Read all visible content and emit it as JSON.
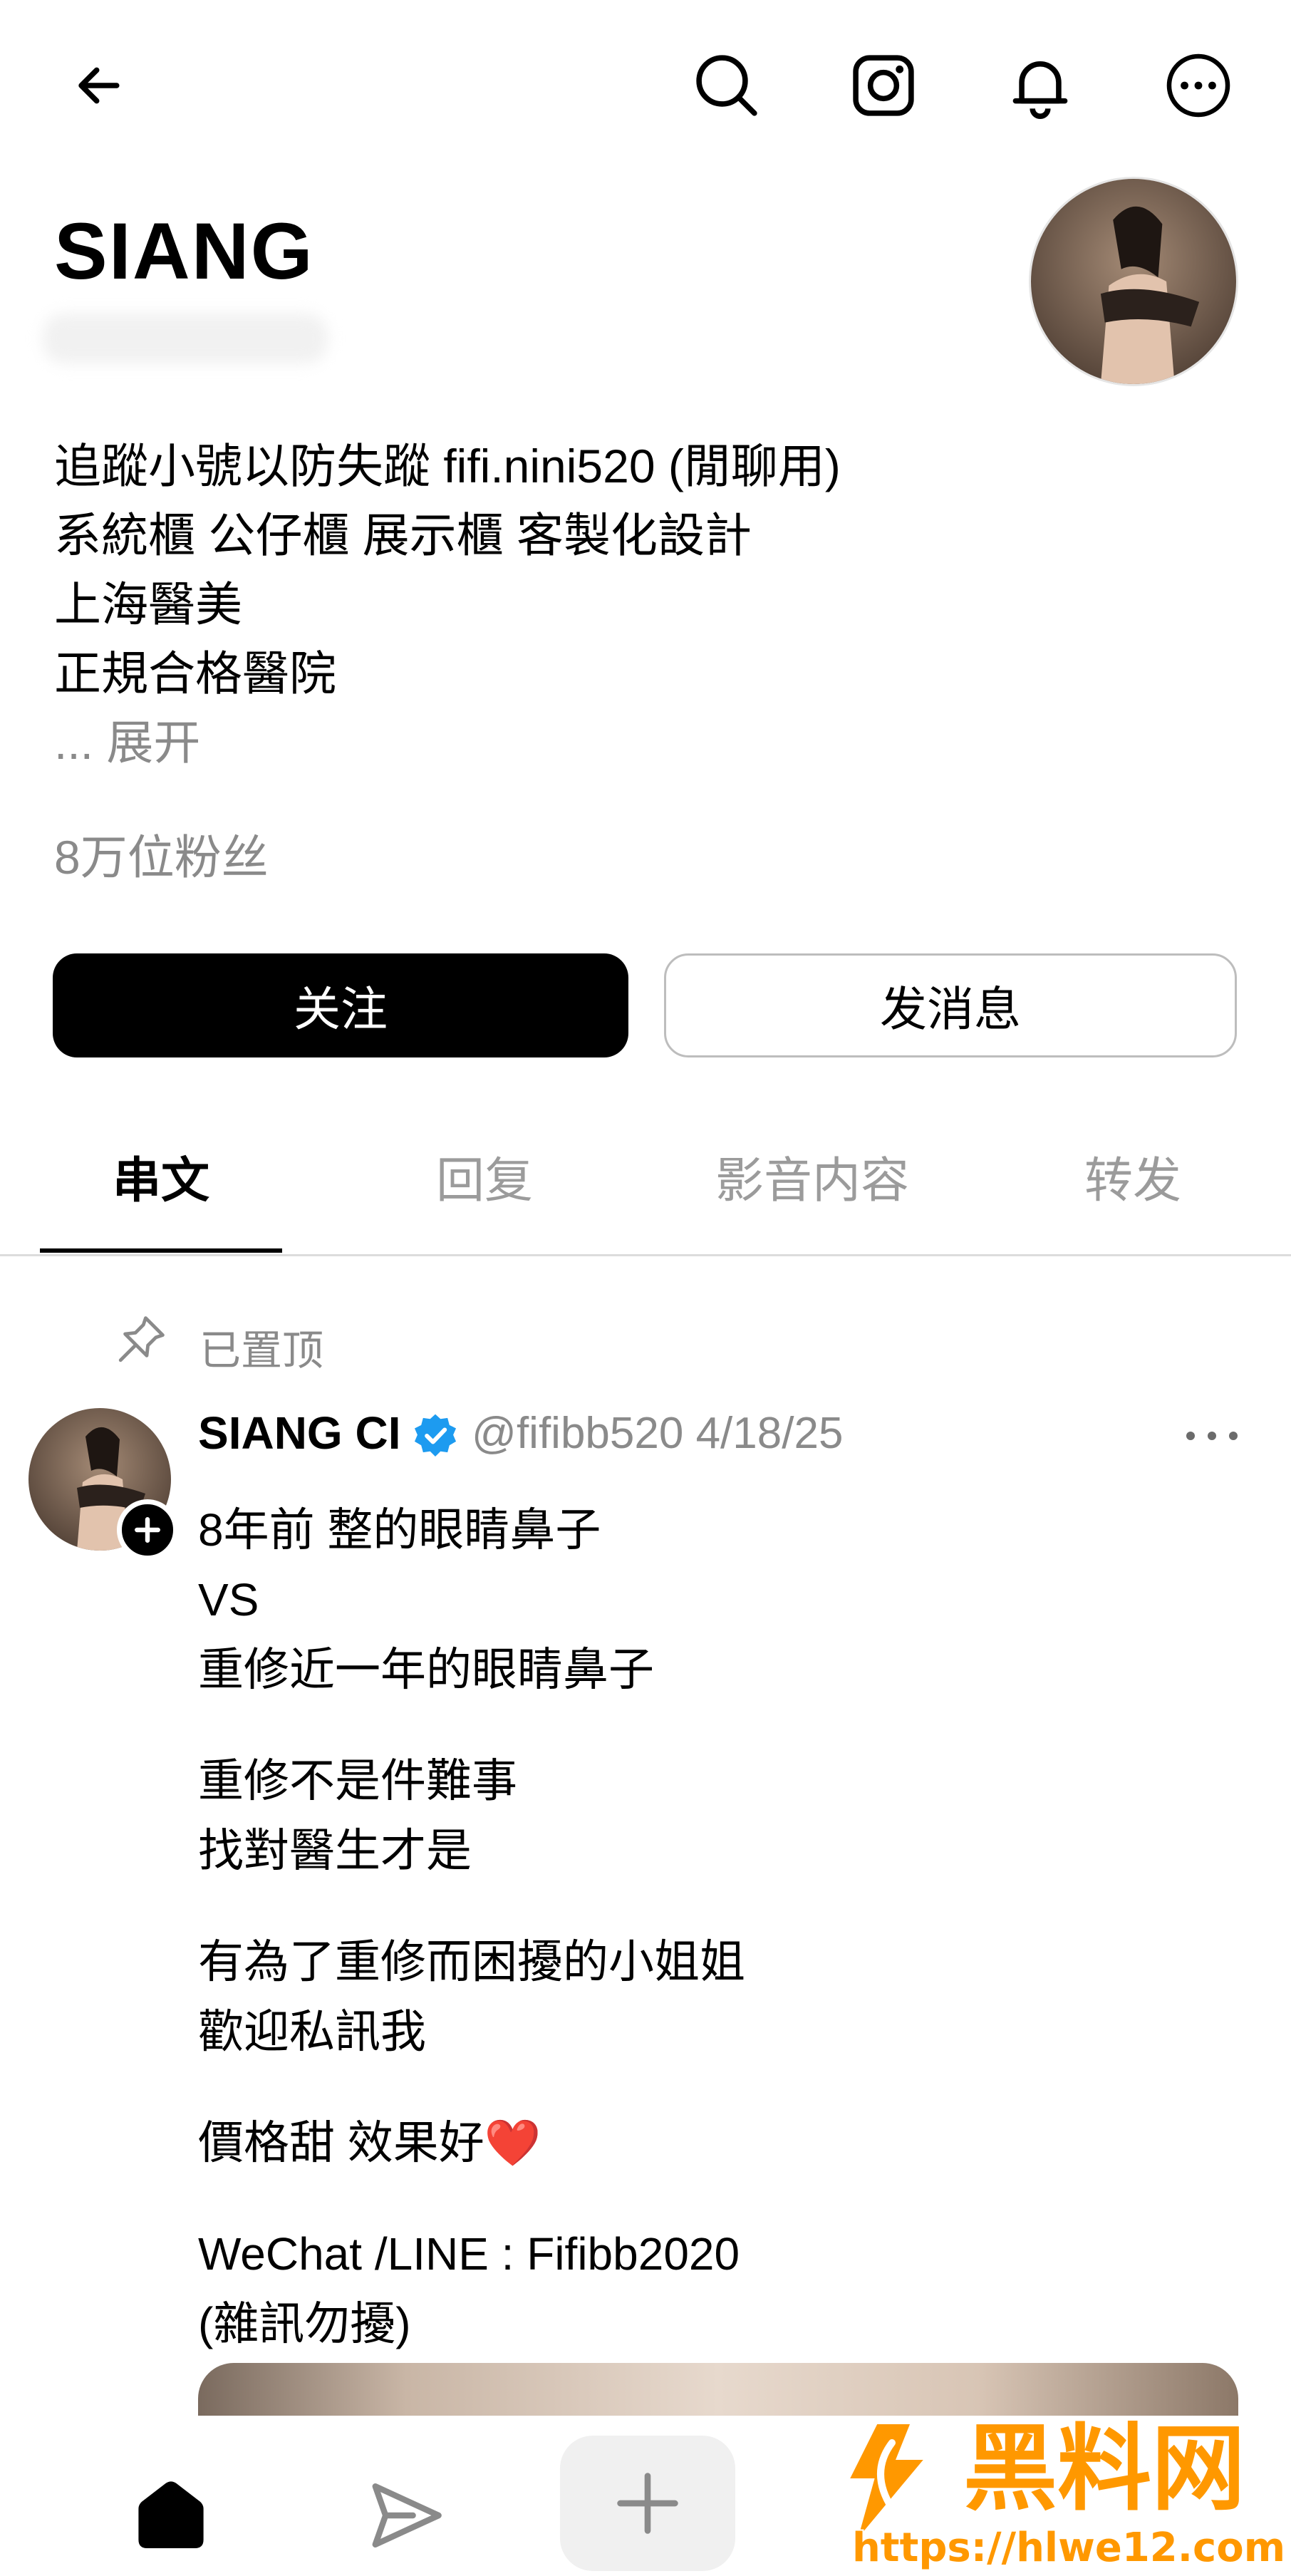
{
  "topbar": {
    "icons": [
      "back-arrow-icon",
      "search-icon",
      "instagram-icon",
      "bell-icon",
      "more-horizontal-icon"
    ]
  },
  "profile": {
    "name": "SIANG",
    "bio_lines": [
      "追蹤小號以防失蹤 fifi.nini520 (閒聊用)",
      "系統櫃 公仔櫃 展示櫃 客製化設計",
      "上海醫美",
      "正規合格醫院"
    ],
    "expand_label": "... 展开",
    "followers": "8万位粉丝"
  },
  "actions": {
    "follow_label": "关注",
    "message_label": "发消息"
  },
  "tabs": [
    {
      "label": "串文",
      "active": true
    },
    {
      "label": "回复",
      "active": false
    },
    {
      "label": "影音内容",
      "active": false
    },
    {
      "label": "转发",
      "active": false
    }
  ],
  "pinned_label": "已置顶",
  "post": {
    "author": "SIANG CI",
    "handle": "@fifibb520 4/18/25",
    "paragraphs": [
      [
        "8年前 整的眼睛鼻子",
        "VS",
        "重修近一年的眼睛鼻子"
      ],
      [
        "重修不是件難事",
        "找對醫生才是"
      ],
      [
        "有為了重修而困擾的小姐姐",
        "歡迎私訊我"
      ],
      [
        "價格甜 效果好❤️"
      ],
      [
        "WeChat /LINE : Fifibb2020",
        "(雜訊勿擾)"
      ]
    ]
  },
  "bottom_nav": {
    "icons": [
      "home-icon",
      "send-icon",
      "create-plus-icon"
    ]
  },
  "watermark": {
    "text": "黑料网",
    "url": "https://hlwe12.com"
  },
  "colors": {
    "primary": "#000000",
    "muted": "#8a8a8a",
    "verified": "#1d9bf0",
    "watermark": "#ff9800"
  }
}
